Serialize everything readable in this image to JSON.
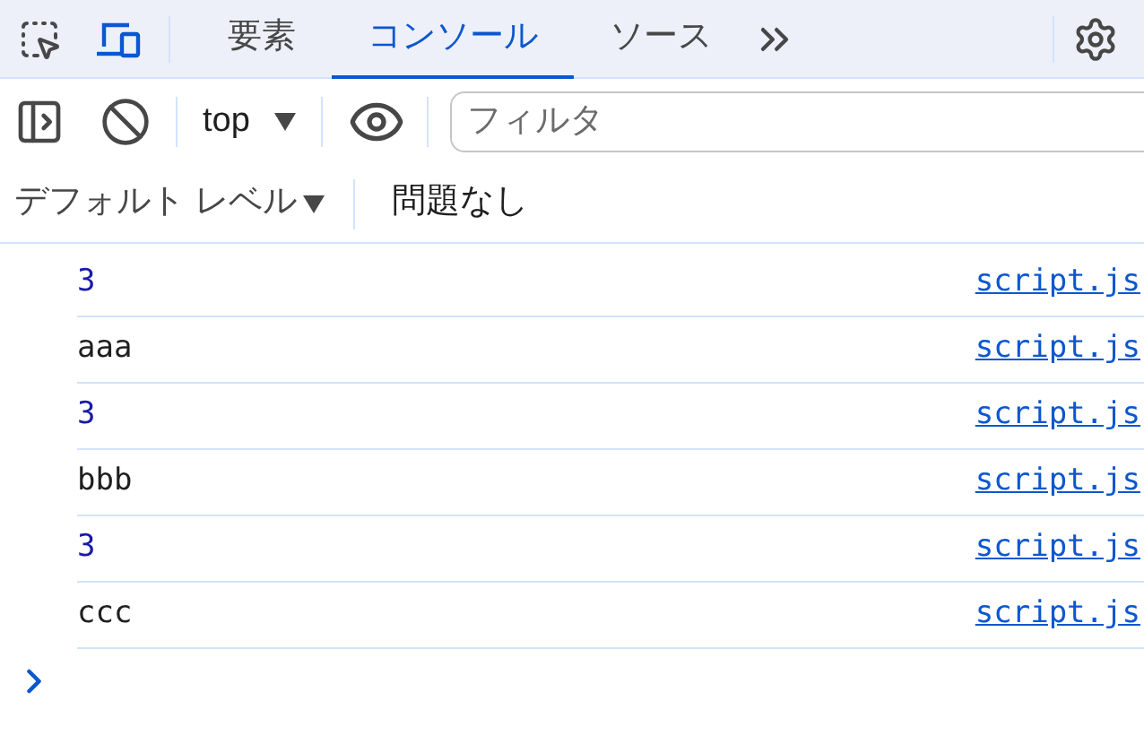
{
  "tabs": [
    {
      "label": "要素",
      "selected": false
    },
    {
      "label": "コンソール",
      "selected": true
    },
    {
      "label": "ソース",
      "selected": false
    }
  ],
  "device_toggle": {
    "on": true
  },
  "context": {
    "value": "top"
  },
  "filter": {
    "placeholder": "フィルタ"
  },
  "levels": {
    "label": "デフォルト レベル"
  },
  "issues": "問題なし",
  "messages": [
    {
      "kind": "number",
      "text": "3",
      "source": "script.js"
    },
    {
      "kind": "string",
      "text": "aaa",
      "source": "script.js"
    },
    {
      "kind": "number",
      "text": "3",
      "source": "script.js"
    },
    {
      "kind": "string",
      "text": "bbb",
      "source": "script.js"
    },
    {
      "kind": "number",
      "text": "3",
      "source": "script.js"
    },
    {
      "kind": "string",
      "text": "ccc",
      "source": "script.js"
    }
  ]
}
